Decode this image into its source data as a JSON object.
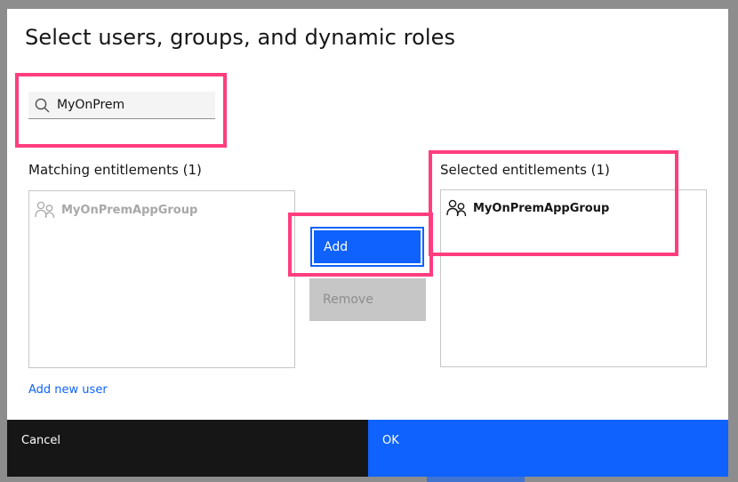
{
  "dialog": {
    "title": "Select users, groups, and dynamic roles"
  },
  "search": {
    "value": "MyOnPrem",
    "icon": "search-icon"
  },
  "matching": {
    "heading": "Matching entitlements (1)",
    "items": [
      {
        "icon": "user-group-icon",
        "label": "MyOnPremAppGroup"
      }
    ]
  },
  "selected": {
    "heading": "Selected entitlements (1)",
    "items": [
      {
        "icon": "user-group-icon",
        "label": "MyOnPremAppGroup"
      }
    ]
  },
  "actions": {
    "add_label": "Add",
    "remove_label": "Remove",
    "add_new_user_label": "Add new user"
  },
  "footer": {
    "cancel_label": "Cancel",
    "ok_label": "OK"
  },
  "colors": {
    "primary": "#0f62fe",
    "highlight": "#ff3d7f",
    "dark": "#161616",
    "disabled": "#c6c6c6"
  }
}
